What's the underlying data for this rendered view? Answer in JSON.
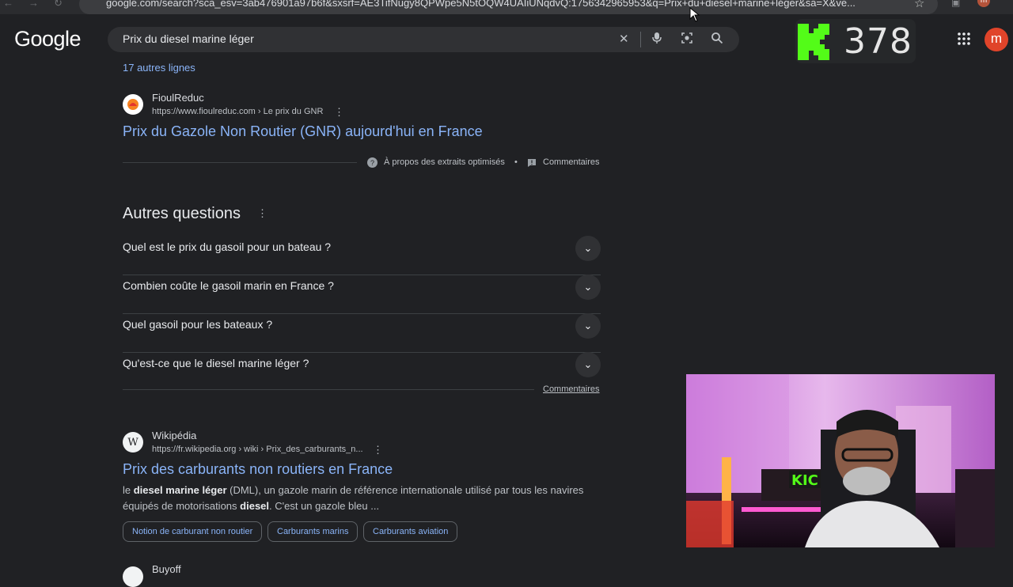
{
  "browser": {
    "url": "google.com/search?sca_esv=3ab476901a97b6f&sxsrf=AE3TifNugy8QPWpe5N5tOQW4UAIiUNqdvQ:1756342965953&q=Prix+du+diesel+marine+léger&sa=X&ve..."
  },
  "header": {
    "logo": "Google",
    "search_value": "Prix du diesel marine léger",
    "avatar_letter": "m",
    "mini_avatar_letter": "m"
  },
  "overlay": {
    "count": "378"
  },
  "results_top": {
    "more_lines": "17 autres lignes",
    "site_name": "FioulReduc",
    "site_url": "https://www.fioulreduc.com › Le prix du GNR",
    "title": "Prix du Gazole Non Routier (GNR) aujourd'hui en France",
    "about_snippets": "À propos des extraits optimisés",
    "feedback": "Commentaires"
  },
  "questions": {
    "title": "Autres questions",
    "items": [
      "Quel est le prix du gasoil pour un bateau ?",
      "Combien coûte le gasoil marin en France ?",
      "Quel gasoil pour les bateaux ?",
      "Qu'est-ce que le diesel marine léger ?"
    ],
    "feedback": "Commentaires"
  },
  "wiki": {
    "site_name": "Wikipédia",
    "site_url": "https://fr.wikipedia.org › wiki › Prix_des_carburants_n...",
    "title": "Prix des carburants non routiers en France",
    "snippet_p1": "le ",
    "snippet_b1": "diesel marine léger",
    "snippet_p2": " (DML), un gazole marin de référence internationale utilisé par tous les navires équipés de motorisations ",
    "snippet_b2": "diesel",
    "snippet_p3": ". C'est un gazole bleu ...",
    "chips": [
      "Notion de carburant non routier",
      "Carburants marins",
      "Carburants aviation"
    ]
  },
  "next_result": {
    "site_name_partial": "Buyoff"
  },
  "colors": {
    "background": "#202124",
    "link": "#8ab4f8",
    "kick_green": "#53fc18",
    "avatar": "#e0442a"
  }
}
